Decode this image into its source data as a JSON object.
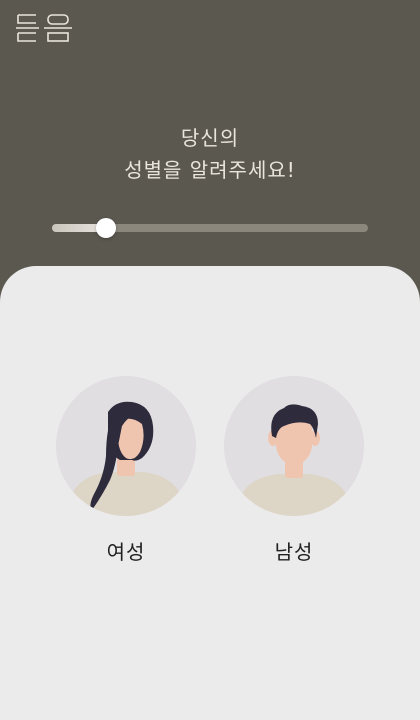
{
  "header": {
    "logo_icon": "logo-icon"
  },
  "question": {
    "line1": "당신의",
    "line2": "성별을 알려주세요!"
  },
  "progress": {
    "value": 0.17
  },
  "options": {
    "female": {
      "label": "여성",
      "icon": "female-avatar-icon"
    },
    "male": {
      "label": "남성",
      "icon": "male-avatar-icon"
    }
  },
  "colors": {
    "header_bg": "#5b5850",
    "sheet_bg": "#ebebeb",
    "avatar_bg": "#e1dee2",
    "hair": "#2e2b3d",
    "skin": "#f0c5b0",
    "shirt": "#ddd5c6"
  }
}
